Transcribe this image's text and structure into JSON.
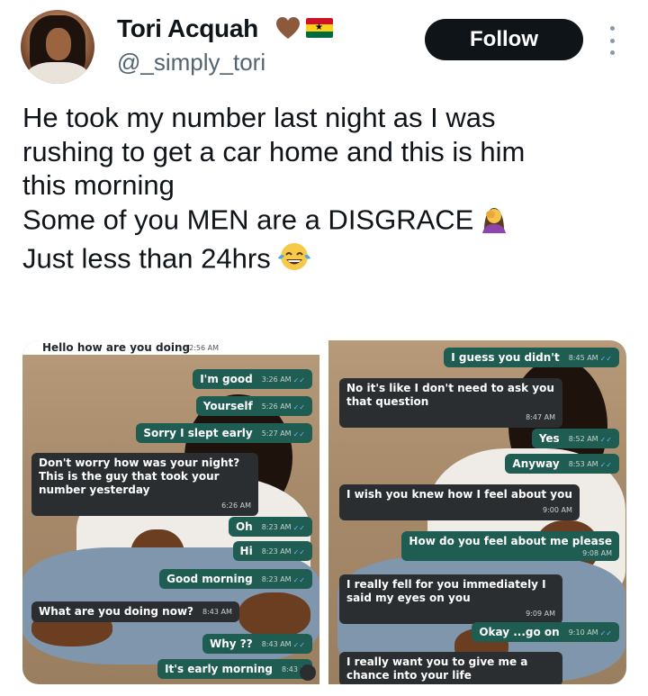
{
  "author": {
    "name": "Tori Acquah",
    "handle": "@_simply_tori",
    "follow_label": "Follow"
  },
  "tweet": {
    "lines": [
      "He took my number last night as I was",
      "rushing to get a car home and this is him",
      "this morning",
      "Some of you MEN are a DISGRACE",
      "Just less than 24hrs"
    ]
  },
  "left_chat": {
    "header_text": "Hello how are you doing",
    "header_time": "12:56 AM",
    "messages": [
      {
        "text": "I'm good",
        "time": "3:26 AM"
      },
      {
        "text": "Yourself",
        "time": "5:26 AM"
      },
      {
        "text": "Sorry I slept early",
        "time": "5:27 AM"
      },
      {
        "text": "Don't worry how was your night? This is the guy that took your number yesterday",
        "time": "6:26 AM"
      },
      {
        "text": "Oh",
        "time": "8:23 AM"
      },
      {
        "text": "Hi",
        "time": "8:23 AM"
      },
      {
        "text": "Good morning",
        "time": "8:23 AM"
      },
      {
        "text": "What are you doing now?",
        "time": "8:43 AM"
      },
      {
        "text": "Why ??",
        "time": "8:43 AM"
      },
      {
        "text": "It's early morning",
        "time": "8:43 A"
      }
    ]
  },
  "right_chat": {
    "messages": [
      {
        "text": "I guess you didn't",
        "time": "8:45 AM"
      },
      {
        "text": "No it's like I don't need to ask you that question",
        "time": "8:47 AM"
      },
      {
        "text": "Yes",
        "time": "8:52 AM"
      },
      {
        "text": "Anyway",
        "time": "8:53 AM"
      },
      {
        "text": "I wish you knew how I feel about you",
        "time": "9:00 AM"
      },
      {
        "text": "How do you feel about me please",
        "time": "9:08 AM"
      },
      {
        "text": "I really fell for you immediately I said my eyes on you",
        "time": "9:09 AM"
      },
      {
        "text": "Okay ...go on",
        "time": "9:10 AM"
      },
      {
        "text": "I really want you to give me a chance into your life",
        "time": ""
      }
    ]
  },
  "icons": {
    "heart": "brown-heart-icon",
    "flag": "ghana-flag-icon",
    "facepalm": "woman-facepalming-emoji",
    "laugh": "tears-of-joy-emoji",
    "more": "more-options-icon"
  },
  "colors": {
    "follow_bg": "#0f1419",
    "outgoing_bubble": "#1f5c52",
    "incoming_bubble": "#2a2e31",
    "heart": "#8b5a3c"
  }
}
